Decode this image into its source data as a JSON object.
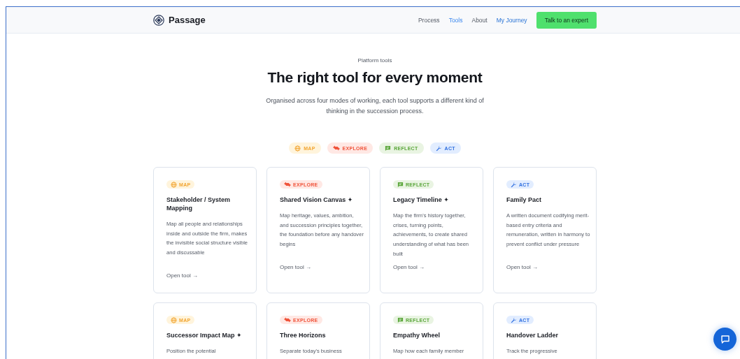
{
  "brand": {
    "name": "Passage"
  },
  "nav": [
    {
      "label": "Process",
      "selected": false,
      "kind": "page"
    },
    {
      "label": "Tools",
      "selected": true,
      "kind": "page"
    },
    {
      "label": "About",
      "selected": false,
      "kind": "page"
    },
    {
      "label": "My Journey",
      "selected": false,
      "kind": "account"
    }
  ],
  "cta": {
    "label": "Talk to an expert"
  },
  "hero": {
    "eyebrow": "Platform tools",
    "title": "The right tool for every moment",
    "description": "Organised across four modes of working, each tool supports a different kind of thinking in the succession process."
  },
  "modes": [
    {
      "label": "MAP",
      "kind": "map"
    },
    {
      "label": "EXPLORE",
      "kind": "explore"
    },
    {
      "label": "REFLECT",
      "kind": "reflect"
    },
    {
      "label": "ACT",
      "kind": "act"
    }
  ],
  "tools": [
    {
      "tag": "MAP",
      "kind": "map",
      "title": "Stakeholder / System Mapping",
      "description": "Map all people and relationships inside and outside the firm, makes the invisible social structure visible and discussable",
      "link": "Open tool →"
    },
    {
      "tag": "EXPLORE",
      "kind": "explore",
      "title": "Shared Vision Canvas ✦",
      "description": "Map heritage, values, ambition, and succession principles together, the foundation before any handover begins",
      "link": "Open tool →"
    },
    {
      "tag": "REFLECT",
      "kind": "reflect",
      "title": "Legacy Timeline ✦",
      "description": "Map the firm's history together, crises, turning points, achievements, to create shared understanding of what has been built",
      "link": "Open tool →"
    },
    {
      "tag": "ACT",
      "kind": "act",
      "title": "Family Pact",
      "description": "A written document codifying merit-based entry criteria and remuneration, written in harmony to prevent conflict under pressure",
      "link": "Open tool →"
    },
    {
      "tag": "MAP",
      "kind": "map",
      "title": "Successor Impact Map ✦",
      "description": "Position the potential"
    },
    {
      "tag": "EXPLORE",
      "kind": "explore",
      "title": "Three Horizons",
      "description": "Separate today's business"
    },
    {
      "tag": "REFLECT",
      "kind": "reflect",
      "title": "Empathy Wheel",
      "description": "Map how each family member"
    },
    {
      "tag": "ACT",
      "kind": "act",
      "title": "Handover Ladder",
      "description": "Track the progressive"
    }
  ]
}
